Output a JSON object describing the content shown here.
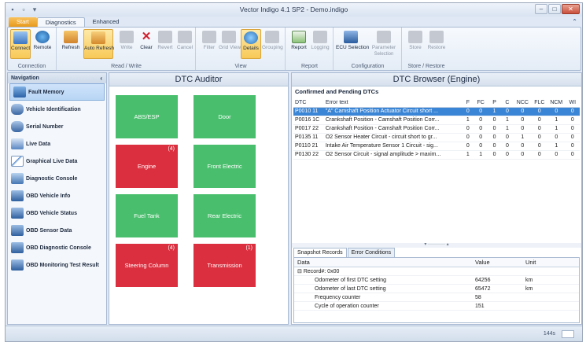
{
  "window": {
    "title": "Vector Indigo 4.1 SP2 - Demo.indigo",
    "minimize": "–",
    "maximize": "□",
    "close": "✕"
  },
  "tabs": {
    "start": "Start",
    "diagnostics": "Diagnostics",
    "enhanced": "Enhanced"
  },
  "ribbon": {
    "groups": {
      "connection": "Connection",
      "read_write": "Read / Write",
      "view": "View",
      "report": "Report",
      "configuration": "Configuration",
      "store_restore": "Store / Restore"
    },
    "buttons": {
      "connect": "Connect",
      "remote": "Remote",
      "refresh": "Refresh",
      "auto_refresh": "Auto Refresh",
      "write": "Write",
      "clear": "Clear",
      "revert": "Revert",
      "cancel": "Cancel",
      "filter": "Filter",
      "grid_view": "Grid View",
      "details": "Details",
      "grouping": "Grouping",
      "report": "Report",
      "logging": "Logging",
      "ecu_selection": "ECU Selection",
      "parameter": "Parameter",
      "selection": "Selection",
      "store": "Store",
      "restore": "Restore"
    }
  },
  "nav": {
    "title": "Navigation",
    "collapse": "‹",
    "items": [
      "Fault Memory",
      "Vehicle Identification",
      "Serial Number",
      "Live Data",
      "Graphical Live Data",
      "Diagnostic Console",
      "OBD Vehicle Info",
      "OBD Vehicle Status",
      "OBD Sensor Data",
      "OBD Diagnostic Console",
      "OBD Monitoring Test Result"
    ]
  },
  "auditor": {
    "title": "DTC Auditor",
    "tiles": [
      {
        "label": "ABS/ESP",
        "count": ""
      },
      {
        "label": "Door",
        "count": ""
      },
      {
        "label": "Engine",
        "count": "(4)"
      },
      {
        "label": "Front Electric",
        "count": ""
      },
      {
        "label": "Fuel Tank",
        "count": ""
      },
      {
        "label": "Rear Electric",
        "count": ""
      },
      {
        "label": "Steering Column",
        "count": "(4)"
      },
      {
        "label": "Transmission",
        "count": "(1)"
      }
    ]
  },
  "browser": {
    "title": "DTC Browser (Engine)",
    "subtitle": "Confirmed and Pending DTCs",
    "columns": [
      "DTC",
      "Error text",
      "F",
      "FC",
      "P",
      "C",
      "NCC",
      "FLC",
      "NCM",
      "WI"
    ],
    "rows": [
      [
        "P0010 11",
        "\"A\" Camshaft Position Actuator Circuit short ...",
        "0",
        "0",
        "1",
        "0",
        "0",
        "0",
        "0",
        "0"
      ],
      [
        "P0016 1C",
        "Crankshaft Position - Camshaft Position Corr...",
        "1",
        "0",
        "0",
        "1",
        "0",
        "0",
        "1",
        "0"
      ],
      [
        "P0017 22",
        "Crankshaft Position - Camshaft Position Corr...",
        "0",
        "0",
        "0",
        "1",
        "0",
        "0",
        "1",
        "0"
      ],
      [
        "P0135 11",
        "O2 Sensor Heater Circuit - circuit short to gr...",
        "0",
        "0",
        "0",
        "0",
        "1",
        "0",
        "0",
        "0"
      ],
      [
        "P0110 21",
        "Intake Air Temperature Sensor 1 Circuit - sig...",
        "0",
        "0",
        "0",
        "0",
        "0",
        "0",
        "1",
        "0"
      ],
      [
        "P0130 22",
        "O2 Sensor Circuit - signal amplitude > maxim...",
        "1",
        "1",
        "0",
        "0",
        "0",
        "0",
        "0",
        "0"
      ]
    ],
    "splitter": "▾ ··········· ▴",
    "snapshot_tabs": [
      "Snapshot Records",
      "Error Conditions"
    ],
    "snapshot_columns": [
      "Data",
      "Value",
      "Unit"
    ],
    "record": "Record#: 0x00",
    "record_toggle": "⊟",
    "snapshot_rows": [
      {
        "name": "Odometer of first DTC setting",
        "value": "64256",
        "unit": "km"
      },
      {
        "name": "Odometer of last DTC setting",
        "value": "65472",
        "unit": "km"
      },
      {
        "name": "Frequency counter",
        "value": "58",
        "unit": ""
      },
      {
        "name": "Cycle of operation counter",
        "value": "151",
        "unit": ""
      }
    ]
  },
  "status": {
    "zoom": "144s"
  },
  "colors": {
    "tile_ok": "#49bf6d",
    "tile_error": "#db2e3e",
    "selection": "#3a85d6",
    "active_button": "#f8c957"
  }
}
